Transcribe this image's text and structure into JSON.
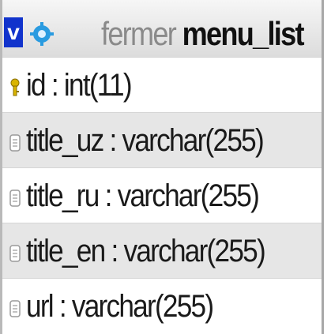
{
  "table": {
    "toggle_label": "v",
    "database": "fermer",
    "name": "menu_list",
    "columns": [
      {
        "text": "id : int(11)",
        "icon": "primary-key-icon",
        "primary_key": true
      },
      {
        "text": "title_uz : varchar(255)",
        "icon": "column-icon",
        "primary_key": false
      },
      {
        "text": "title_ru : varchar(255)",
        "icon": "column-icon",
        "primary_key": false
      },
      {
        "text": "title_en : varchar(255)",
        "icon": "column-icon",
        "primary_key": false
      },
      {
        "text": "url : varchar(255)",
        "icon": "column-icon",
        "primary_key": false
      }
    ]
  },
  "colors": {
    "toggle_bg": "#1133cc",
    "options_icon": "#2a9be0",
    "key_icon": "#d9b400",
    "row_shaded": "#e6e6e6"
  }
}
